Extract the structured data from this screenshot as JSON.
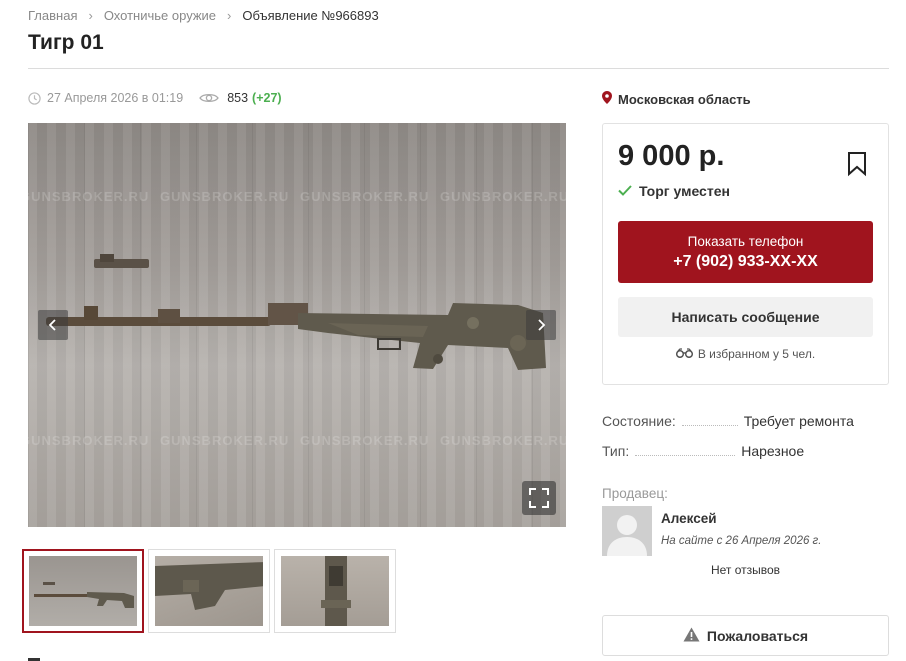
{
  "breadcrumb": {
    "items": [
      "Главная",
      "Охотничье оружие"
    ],
    "current": "Объявление №966893"
  },
  "title": "Тигр 01",
  "meta": {
    "date": "27 Апреля 2026 в 01:19",
    "views": "853",
    "views_delta": "(+27)"
  },
  "gallery": {
    "watermark": "GUNSBROKER.RU",
    "thumbnail_count": 3,
    "active_index": 0
  },
  "location": "Московская область",
  "price_card": {
    "price": "9 000 р.",
    "bargain": "Торг уместен",
    "phone_label": "Показать телефон",
    "phone_number": "+7 (902) 933-XX-XX",
    "message_label": "Написать сообщение",
    "favorites": "В избранном у 5 чел."
  },
  "params": [
    {
      "label": "Состояние:",
      "value": "Требует ремонта"
    },
    {
      "label": "Тип:",
      "value": "Нарезное"
    }
  ],
  "seller": {
    "section_label": "Продавец:",
    "name": "Алексей",
    "since": "На сайте с 26 Апреля 2026 г.",
    "reviews": "Нет отзывов"
  },
  "report_label": "Пожаловаться",
  "colors": {
    "accent": "#a0141e",
    "bargain_check": "#4caf50",
    "views_delta": "#4caf50"
  }
}
